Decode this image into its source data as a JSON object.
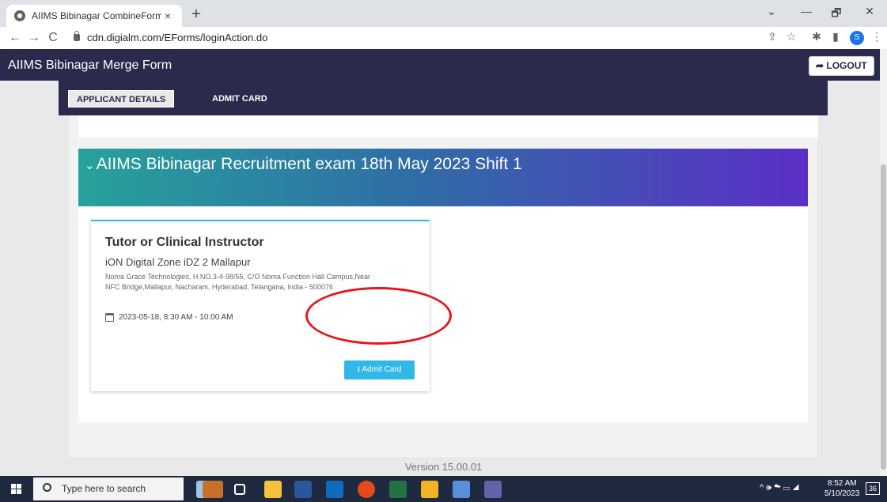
{
  "browser": {
    "tab_title": "AIIMS Bibinagar CombineForm",
    "tab_close": "×",
    "new_tab": "+",
    "url": "cdn.digialm.com/EForms/loginAction.do",
    "window": {
      "minimize": "—",
      "restore": "🗗",
      "close": "✕",
      "tabs_dropdown": "⌄"
    },
    "nav": {
      "back": "←",
      "forward": "→",
      "reload": "C"
    },
    "profile_initial": "S"
  },
  "header": {
    "title": "AIIMS Bibinagar Merge Form",
    "logout_label": "➦ LOGOUT"
  },
  "subnav": {
    "tabs": [
      {
        "label": "APPLICANT DETAILS",
        "active": true
      },
      {
        "label": "ADMIT CARD",
        "active": false
      }
    ]
  },
  "exam": {
    "title": "AIIMS Bibinagar Recruitment exam 18th May 2023 Shift 1",
    "chevron": "⌄",
    "post": {
      "title": "Tutor or Clinical Instructor",
      "venue": "iON Digital Zone iDZ 2 Mallapur",
      "address": "Noma Grace Technologies, H.NO.3-4-98/55, C/O Noma Function Hall Campus,Near NFC Bridge,Mallapur, Nacharam, Hyderabad, Telangana, India - 500076",
      "schedule": "2023-05-18, 8:30 AM - 10:00 AM",
      "admit_card_label": "⭳ Admit Card"
    }
  },
  "version_text": "Version 15.00.01",
  "taskbar": {
    "search_placeholder": "Type here to search",
    "time": "8:52 AM",
    "date": "5/10/2023",
    "notifications": "36",
    "tray_icons": "^ 🕪 ☁ ▭ ◢"
  },
  "colors": {
    "header_bg": "#2a2a4c",
    "banner_start": "#27a29c",
    "banner_end": "#5b2ec6",
    "admit_button": "#2fb8e8",
    "highlight": "#e8151b"
  }
}
